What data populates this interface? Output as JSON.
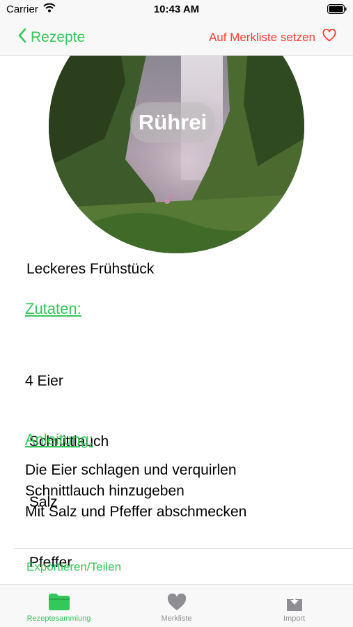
{
  "status_bar": {
    "carrier": "Carrier",
    "time": "10:43 AM"
  },
  "nav": {
    "back_label": "Rezepte",
    "action_label": "Auf Merkliste setzen"
  },
  "recipe": {
    "title": "Rührei",
    "subtitle": "Leckeres Frühstück",
    "ingredients_heading": "Zutaten:",
    "ingredients": [
      "4 Eier",
      " Schnittlauch",
      " Salz",
      " Pfeffer"
    ],
    "instructions_heading": "Anleitung:",
    "instructions": [
      "Die Eier schlagen und verquirlen",
      "Schnittlauch hinzugeben",
      "Mit Salz und Pfeffer abschmecken"
    ]
  },
  "export_label": "Exportieren/Teilen",
  "tabs": [
    {
      "label": "Rezeptesammlung",
      "icon": "folder-icon",
      "active": true
    },
    {
      "label": "Merkliste",
      "icon": "heart-icon",
      "active": false
    },
    {
      "label": "Import",
      "icon": "download-tray-icon",
      "active": false
    }
  ],
  "colors": {
    "accent_green": "#34c759",
    "action_red": "#ff3b30",
    "inactive_gray": "#8e8e93"
  }
}
